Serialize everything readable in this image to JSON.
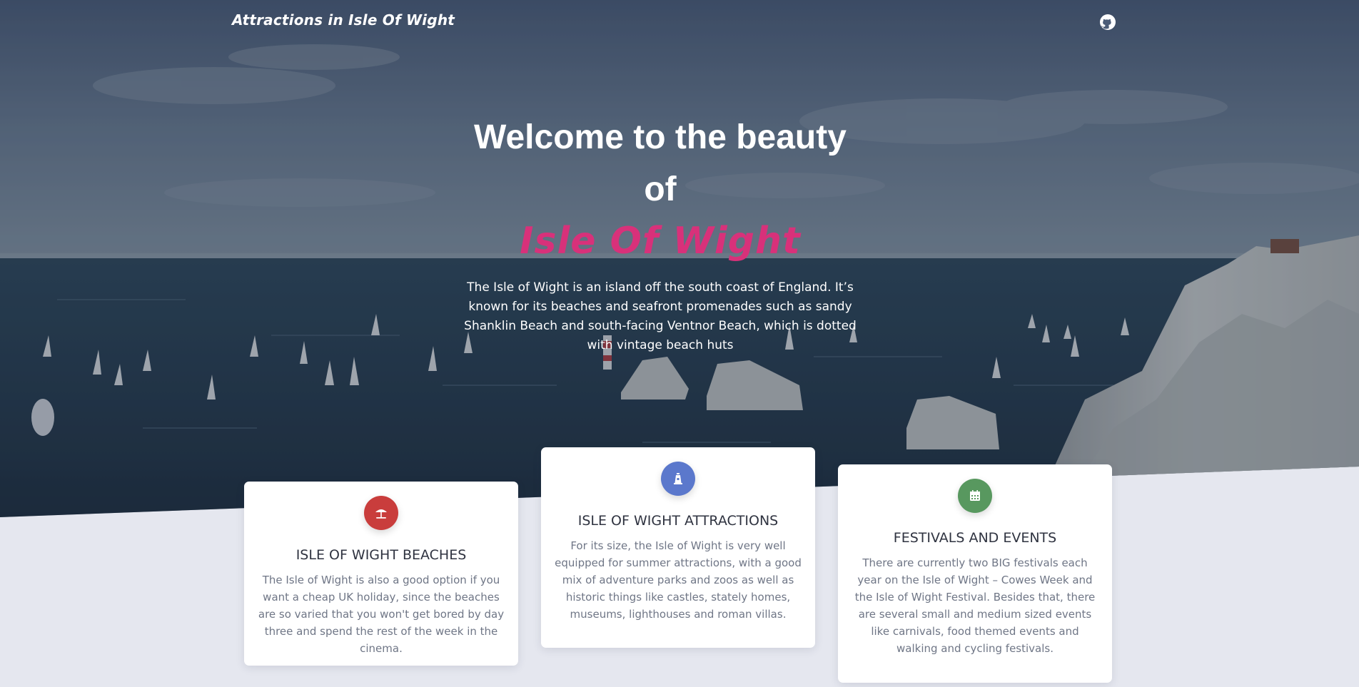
{
  "nav": {
    "brand": "Attractions in Isle Of Wight",
    "github_icon": "github-icon"
  },
  "hero": {
    "title": "Welcome to the beauty of",
    "highlight": "Isle Of Wight",
    "description": "The Isle of Wight is an island off the south coast of England. It’s known for its beaches and seafront promenades such as sandy Shanklin Beach and south-facing Ventnor Beach, which is dotted with vintage beach huts",
    "highlight_color": "#d8317a"
  },
  "cards": [
    {
      "icon": "beach-umbrella-icon",
      "icon_color": "#c93d3c",
      "title": "ISLE OF WIGHT BEACHES",
      "text": "The Isle of Wight is also a good option if you want a cheap UK holiday, since the beaches are so varied that you won't get bored by day three and spend the rest of the week in the cinema."
    },
    {
      "icon": "lighthouse-icon",
      "icon_color": "#5b78cc",
      "title": "ISLE OF WIGHT ATTRACTIONS",
      "text": "For its size, the Isle of Wight is very well equipped for summer attractions, with a good mix of adventure parks and zoos as well as historic things like castles, stately homes, museums, lighthouses and roman villas."
    },
    {
      "icon": "calendar-icon",
      "icon_color": "#58985f",
      "title": "FESTIVALS AND EVENTS",
      "text": "There are currently two BIG festivals each year on the Isle of Wight – Cowes Week and the Isle of Wight Festival. Besides that, there are several small and medium sized events like carnivals, food themed events and walking and cycling festivals."
    }
  ],
  "colors": {
    "page_background": "#e5e7ef",
    "card_background": "#ffffff"
  }
}
